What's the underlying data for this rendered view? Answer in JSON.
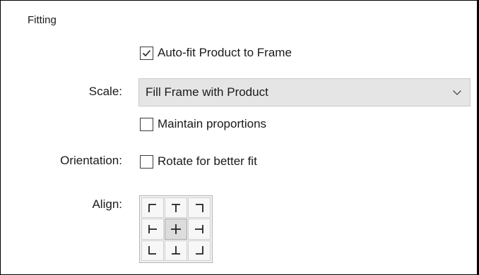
{
  "group": {
    "title": "Fitting"
  },
  "autofit": {
    "label": "Auto-fit Product to Frame",
    "checked": true
  },
  "scale": {
    "label": "Scale:",
    "value": "Fill Frame with Product"
  },
  "maintain": {
    "label": "Maintain proportions",
    "checked": false
  },
  "orientation": {
    "label": "Orientation:",
    "checkbox_label": "Rotate for better fit",
    "checked": false
  },
  "align": {
    "label": "Align:",
    "selected": "middle-center",
    "cells": [
      "top-left",
      "top-center",
      "top-right",
      "middle-left",
      "middle-center",
      "middle-right",
      "bottom-left",
      "bottom-center",
      "bottom-right"
    ]
  }
}
